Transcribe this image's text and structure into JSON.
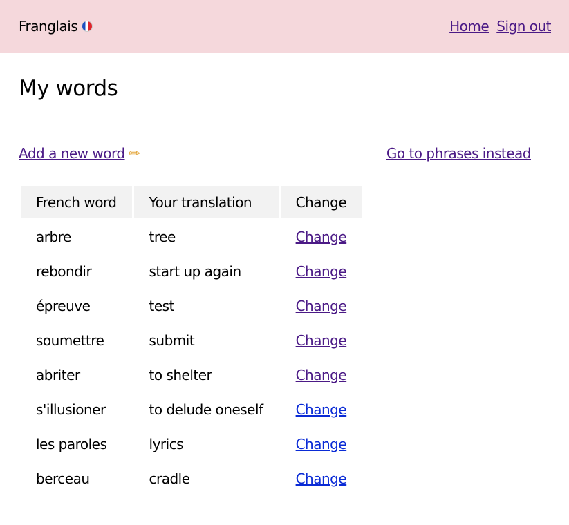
{
  "header": {
    "brand": "Franglais",
    "flag_icon": "french-flag-icon",
    "nav": [
      {
        "label": "Home"
      },
      {
        "label": "Sign out"
      }
    ]
  },
  "main": {
    "title": "My words",
    "add_link": "Add a new word",
    "add_icon": "pencil-icon",
    "phrases_link": "Go to phrases instead"
  },
  "table": {
    "columns": [
      "French word",
      "Your translation",
      "Change"
    ],
    "rows": [
      {
        "french": "arbre",
        "translation": "tree",
        "action": "Change",
        "visited": true
      },
      {
        "french": "rebondir",
        "translation": "start up again",
        "action": "Change",
        "visited": true
      },
      {
        "french": "épreuve",
        "translation": "test",
        "action": "Change",
        "visited": true
      },
      {
        "french": "soumettre",
        "translation": "submit",
        "action": "Change",
        "visited": true
      },
      {
        "french": "abriter",
        "translation": "to shelter",
        "action": "Change",
        "visited": true
      },
      {
        "french": "s'illusioner",
        "translation": "to delude oneself",
        "action": "Change",
        "visited": false
      },
      {
        "french": "les paroles",
        "translation": "lyrics",
        "action": "Change",
        "visited": false
      },
      {
        "french": "berceau",
        "translation": "cradle",
        "action": "Change",
        "visited": false
      }
    ]
  },
  "colors": {
    "header_bg": "#f5d8dc",
    "visited_link": "#4b1a86",
    "link": "#0a2bd6",
    "table_header_bg": "#f2f2f2"
  }
}
